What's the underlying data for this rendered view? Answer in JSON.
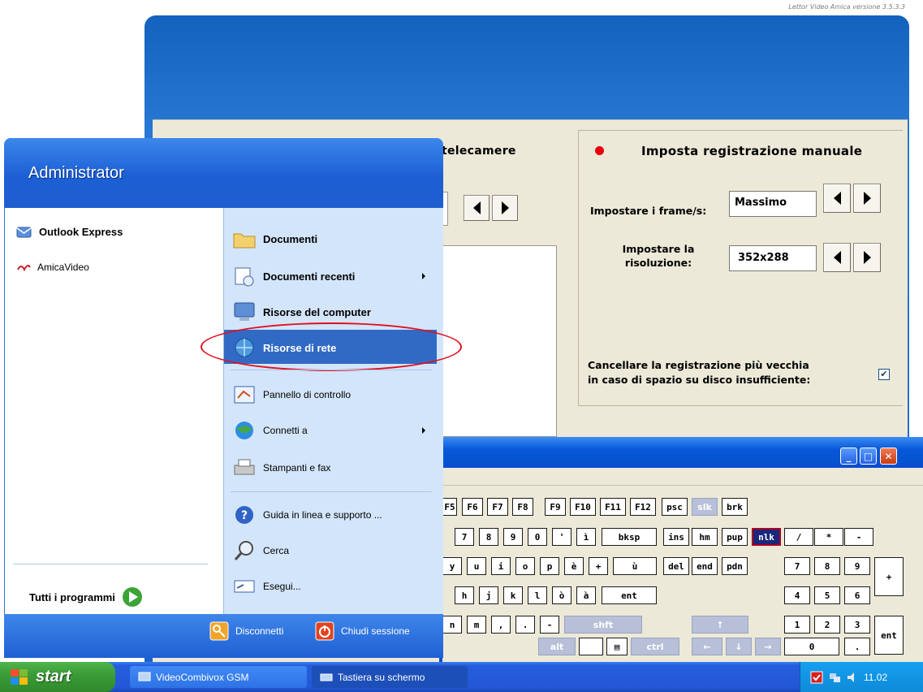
{
  "app": {
    "version": "Lettor Video Amica versione 3.5.3.3",
    "left_panel_title": "telecamere",
    "right_panel_title": "Imposta registrazione manuale",
    "fps_label": "Impostare i frame/s:",
    "fps_value": "Massimo",
    "resolution_label_1": "Impostare la",
    "resolution_label_2": "risoluzione:",
    "resolution_value": "352x288",
    "delete_label_1": "Cancellare la registrazione più vecchia",
    "delete_label_2": "in caso di spazio su disco insufficiente:",
    "delete_checked": "✔",
    "record_dot_color": "#e8000f"
  },
  "start_menu": {
    "user": "Administrator",
    "pinned": [
      {
        "label": "Outlook Express",
        "icon": "outlook-express-icon"
      },
      {
        "label": "AmicaVideo",
        "icon": "amicavideo-icon"
      }
    ],
    "all_programs": "Tutti i programmi",
    "right_items": [
      {
        "label": "Documenti",
        "icon": "folder-icon"
      },
      {
        "label": "Documenti recenti",
        "icon": "recent-docs-icon"
      },
      {
        "label": "Risorse del computer",
        "icon": "computer-icon"
      },
      {
        "label": "Risorse di rete",
        "icon": "network-icon"
      },
      {
        "label": "Pannello di controllo",
        "icon": "control-panel-icon"
      },
      {
        "label": "Connetti a",
        "icon": "connect-icon"
      },
      {
        "label": "Stampanti e fax",
        "icon": "printer-icon"
      },
      {
        "label": "Guida in linea e supporto ...",
        "icon": "help-icon"
      },
      {
        "label": "Cerca",
        "icon": "search-icon"
      },
      {
        "label": "Esegui...",
        "icon": "run-icon"
      }
    ],
    "logoff": "Disconnetti",
    "shutdown": "Chiudi sessione",
    "highlight_color": "#e0101e"
  },
  "keyboard": {
    "keys": [
      {
        "label": "F5",
        "cls": ""
      },
      {
        "label": "F6",
        "cls": ""
      },
      {
        "label": "F7",
        "cls": ""
      },
      {
        "label": "F8",
        "cls": ""
      },
      {
        "label": "F9",
        "cls": ""
      },
      {
        "label": "F10",
        "cls": ""
      },
      {
        "label": "F11",
        "cls": ""
      },
      {
        "label": "F12",
        "cls": ""
      },
      {
        "label": "psc",
        "cls": ""
      },
      {
        "label": "slk",
        "cls": "grey"
      },
      {
        "label": "brk",
        "cls": ""
      },
      {
        "label": "7",
        "cls": ""
      },
      {
        "label": "8",
        "cls": ""
      },
      {
        "label": "9",
        "cls": ""
      },
      {
        "label": "0",
        "cls": ""
      },
      {
        "label": "'",
        "cls": ""
      },
      {
        "label": "ì",
        "cls": ""
      },
      {
        "label": "bksp",
        "cls": ""
      },
      {
        "label": "ins",
        "cls": ""
      },
      {
        "label": "hm",
        "cls": ""
      },
      {
        "label": "pup",
        "cls": ""
      },
      {
        "label": "nlk",
        "cls": "sel"
      },
      {
        "label": "/",
        "cls": ""
      },
      {
        "label": "*",
        "cls": ""
      },
      {
        "label": "-",
        "cls": ""
      },
      {
        "label": "y",
        "cls": ""
      },
      {
        "label": "u",
        "cls": ""
      },
      {
        "label": "i",
        "cls": ""
      },
      {
        "label": "o",
        "cls": ""
      },
      {
        "label": "p",
        "cls": ""
      },
      {
        "label": "è",
        "cls": ""
      },
      {
        "label": "+",
        "cls": ""
      },
      {
        "label": "ù",
        "cls": ""
      },
      {
        "label": "del",
        "cls": ""
      },
      {
        "label": "end",
        "cls": ""
      },
      {
        "label": "pdn",
        "cls": ""
      },
      {
        "label": "7",
        "cls": ""
      },
      {
        "label": "8",
        "cls": ""
      },
      {
        "label": "9",
        "cls": ""
      },
      {
        "label": "+",
        "cls": ""
      },
      {
        "label": "h",
        "cls": ""
      },
      {
        "label": "j",
        "cls": ""
      },
      {
        "label": "k",
        "cls": ""
      },
      {
        "label": "l",
        "cls": ""
      },
      {
        "label": "ò",
        "cls": ""
      },
      {
        "label": "à",
        "cls": ""
      },
      {
        "label": "ent",
        "cls": ""
      },
      {
        "label": "4",
        "cls": ""
      },
      {
        "label": "5",
        "cls": ""
      },
      {
        "label": "6",
        "cls": ""
      },
      {
        "label": "n",
        "cls": ""
      },
      {
        "label": "m",
        "cls": ""
      },
      {
        "label": ",",
        "cls": ""
      },
      {
        "label": ".",
        "cls": ""
      },
      {
        "label": "-",
        "cls": ""
      },
      {
        "label": "shft",
        "cls": "grey"
      },
      {
        "label": "↑",
        "cls": "grey"
      },
      {
        "label": "1",
        "cls": ""
      },
      {
        "label": "2",
        "cls": ""
      },
      {
        "label": "3",
        "cls": ""
      },
      {
        "label": "ent",
        "cls": ""
      },
      {
        "label": "alt",
        "cls": "grey"
      },
      {
        "label": "",
        "cls": "grey"
      },
      {
        "label": "▤",
        "cls": ""
      },
      {
        "label": "ctrl",
        "cls": "grey"
      },
      {
        "label": "←",
        "cls": "grey"
      },
      {
        "label": "↓",
        "cls": "grey"
      },
      {
        "label": "→",
        "cls": "grey"
      },
      {
        "label": "0",
        "cls": ""
      },
      {
        "label": ".",
        "cls": ""
      }
    ]
  },
  "taskbar": {
    "start": "start",
    "tasks": [
      {
        "label": "VideoCombivox GSM",
        "icon": "monitor-icon"
      },
      {
        "label": "Tastiera su schermo",
        "icon": "keyboard-icon"
      }
    ],
    "clock": "11.02"
  }
}
